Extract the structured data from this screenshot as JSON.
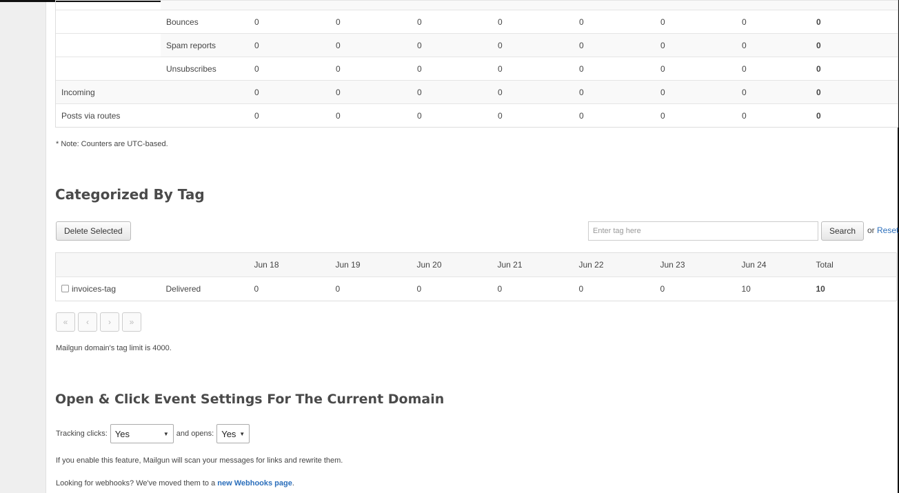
{
  "stats": {
    "rows": [
      {
        "group": "",
        "label": "Bounces",
        "values": [
          "0",
          "0",
          "0",
          "0",
          "0",
          "0",
          "0"
        ],
        "total": "0"
      },
      {
        "group": "",
        "label": "Spam reports",
        "values": [
          "0",
          "0",
          "0",
          "0",
          "0",
          "0",
          "0"
        ],
        "total": "0"
      },
      {
        "group": "",
        "label": "Unsubscribes",
        "values": [
          "0",
          "0",
          "0",
          "0",
          "0",
          "0",
          "0"
        ],
        "total": "0"
      },
      {
        "group": "Incoming",
        "label": "",
        "values": [
          "0",
          "0",
          "0",
          "0",
          "0",
          "0",
          "0"
        ],
        "total": "0"
      },
      {
        "group": "Posts via routes",
        "label": "",
        "values": [
          "0",
          "0",
          "0",
          "0",
          "0",
          "0",
          "0"
        ],
        "total": "0"
      }
    ],
    "note": "* Note: Counters are UTC-based."
  },
  "tags": {
    "heading": "Categorized By Tag",
    "delete_label": "Delete Selected",
    "search_placeholder": "Enter tag here",
    "search_label": "Search",
    "or_text": "or",
    "reset_label": "Reset",
    "columns": [
      "Jun 18",
      "Jun 19",
      "Jun 20",
      "Jun 21",
      "Jun 22",
      "Jun 23",
      "Jun 24",
      "Total"
    ],
    "rows": [
      {
        "tag": "invoices-tag",
        "type": "Delivered",
        "values": [
          "0",
          "0",
          "0",
          "0",
          "0",
          "0",
          "10"
        ],
        "total": "10"
      }
    ],
    "pager": [
      "«",
      "‹",
      "›",
      "»"
    ],
    "limit_note": "Mailgun domain's tag limit is 4000."
  },
  "events": {
    "heading": "Open & Click Event Settings For The Current Domain",
    "tracking_label": "Tracking clicks:",
    "clicks_value": "Yes",
    "opens_label": "and opens:",
    "opens_value": "Yes",
    "info": "If you enable this feature, Mailgun will scan your messages for links and rewrite them.",
    "webhooks_prefix": "Looking for webhooks? We've moved them to a",
    "webhooks_link": "new Webhooks page",
    "webhooks_suffix": "."
  }
}
